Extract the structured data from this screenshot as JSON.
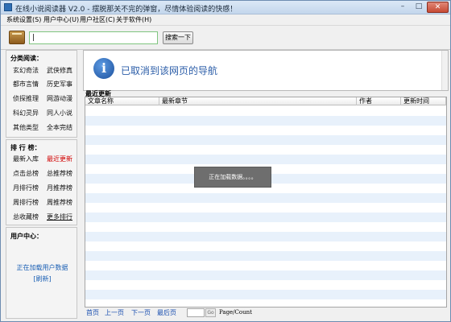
{
  "window": {
    "title": "在线小说阅读器 V2.0 - 摆脱那关不完的弹窗，尽情体验阅读的快感！",
    "min_glyph": "–",
    "max_glyph": "□",
    "close_glyph": "✕"
  },
  "menu": [
    {
      "label": "系统设置(S)"
    },
    {
      "label": "用户中心(U)"
    },
    {
      "label": "用户社区(C)"
    },
    {
      "label": "关于软件(H)"
    }
  ],
  "search": {
    "value": "|",
    "button": "搜索一下"
  },
  "categories": {
    "title": "分类阅读：",
    "items": [
      {
        "label": "玄幻奇法"
      },
      {
        "label": "武侠修真"
      },
      {
        "label": "都市言情"
      },
      {
        "label": "历史军事"
      },
      {
        "label": "侦探推理"
      },
      {
        "label": "网游动漫"
      },
      {
        "label": "科幻灵异"
      },
      {
        "label": "同人小说"
      },
      {
        "label": "其他类型"
      },
      {
        "label": "全本完结"
      }
    ]
  },
  "rankings": {
    "title": "排 行 榜：",
    "items": [
      {
        "label": "最新入库"
      },
      {
        "label": "最近更新"
      },
      {
        "label": "点击总榜"
      },
      {
        "label": "总推荐榜"
      },
      {
        "label": "月排行榜"
      },
      {
        "label": "月推荐榜"
      },
      {
        "label": "周排行榜"
      },
      {
        "label": "周推荐榜"
      },
      {
        "label": "总收藏榜"
      },
      {
        "label": "更多排行"
      }
    ]
  },
  "user_center": {
    "title": "用户中心：",
    "loading": "正在加载用户数据",
    "refresh": "[刷新]"
  },
  "nav": {
    "message": "已取消到该网页的导航"
  },
  "list": {
    "section_label": "最近更新",
    "columns": [
      {
        "label": "文章名称"
      },
      {
        "label": "最新章节"
      },
      {
        "label": "作者"
      },
      {
        "label": "更新时间"
      }
    ],
    "loading": "正在加载数据。。。。"
  },
  "pager": {
    "first": "首页",
    "prev": "上一页",
    "next": "下一页",
    "last": "最后页",
    "go": "Go",
    "count": "Page/Count"
  }
}
